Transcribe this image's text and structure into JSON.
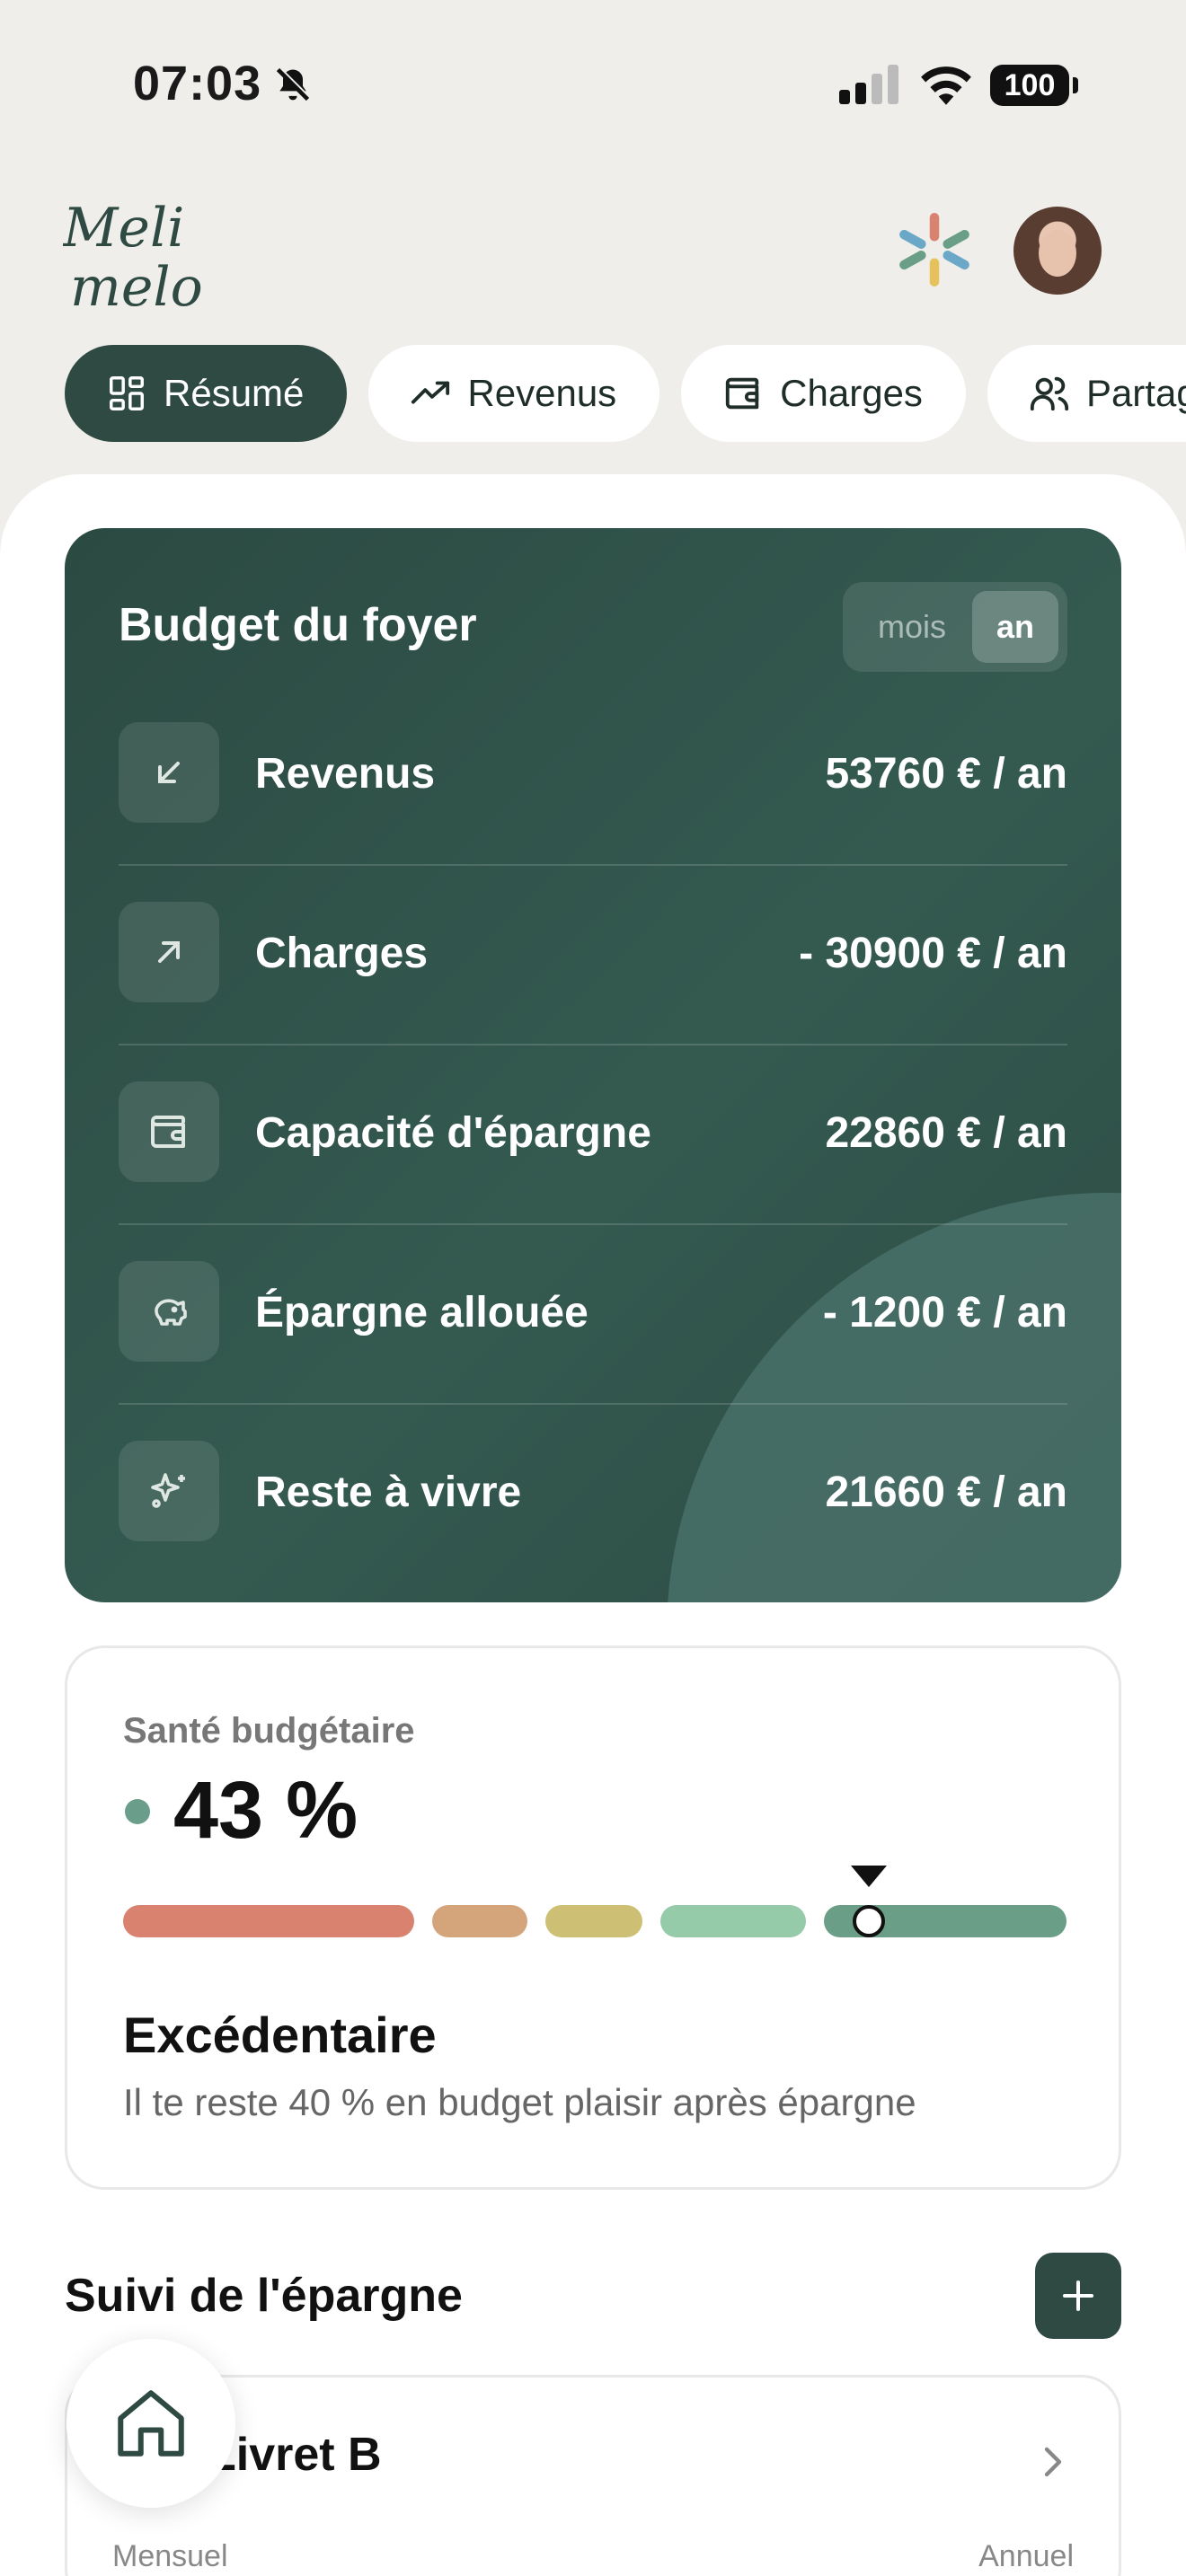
{
  "status_bar": {
    "time": "07:03",
    "battery": "100"
  },
  "header": {
    "logo_text_line1": "Meli",
    "logo_text_line2": "melo"
  },
  "tabs": [
    {
      "label": "Résumé",
      "icon": "grid-icon",
      "active": true
    },
    {
      "label": "Revenus",
      "icon": "trend-up-icon",
      "active": false
    },
    {
      "label": "Charges",
      "icon": "wallet-icon",
      "active": false
    },
    {
      "label": "Partag",
      "icon": "users-icon",
      "active": false
    }
  ],
  "budget": {
    "title": "Budget du foyer",
    "period_options": [
      "mois",
      "an"
    ],
    "period_selected": "an",
    "rows": [
      {
        "label": "Revenus",
        "value": "53760 € / an",
        "icon": "arrow-down-left-icon"
      },
      {
        "label": "Charges",
        "value": "- 30900 € / an",
        "icon": "arrow-up-right-icon"
      },
      {
        "label": "Capacité d'épargne",
        "value": "22860 € / an",
        "icon": "wallet-icon"
      },
      {
        "label": "Épargne allouée",
        "value": "- 1200 € / an",
        "icon": "piggy-bank-icon"
      },
      {
        "label": "Reste à vivre",
        "value": "21660 € / an",
        "icon": "sparkles-icon"
      }
    ]
  },
  "health": {
    "label": "Santé budgétaire",
    "percent": "43 %",
    "gauge_level": 0.79,
    "status": "Excédentaire",
    "description": "Il te reste 40 % en budget plaisir après épargne",
    "colors": [
      "#d9826f",
      "#d4a57a",
      "#cdbf73",
      "#95cba8",
      "#6a9e86"
    ]
  },
  "savings": {
    "title": "Suivi de l'épargne",
    "item": {
      "name": "Livret B",
      "left_label": "Mensuel",
      "right_label": "Annuel"
    }
  },
  "colors": {
    "primary": "#2e4a43",
    "background": "#f0eeeb",
    "accent_dot": "#6a9e8a"
  }
}
